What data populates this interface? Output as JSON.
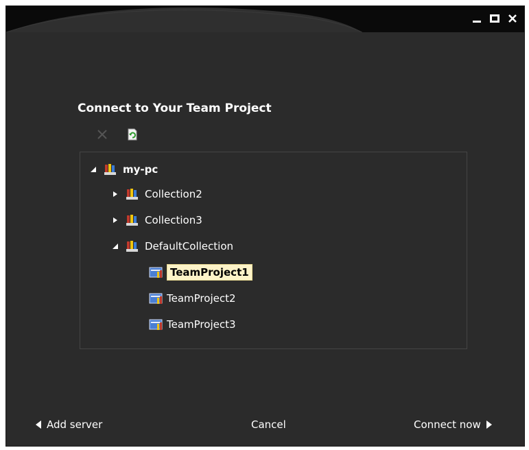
{
  "window": {
    "controls": {
      "minimize": "minimize-icon",
      "maximize": "maximize-icon",
      "close": "close-icon"
    }
  },
  "dialog": {
    "title": "Connect to Your Team Project",
    "toolbar": {
      "delete_icon": "delete-x-icon",
      "refresh_icon": "refresh-icon"
    }
  },
  "tree": {
    "server": {
      "label": "my-pc",
      "expanded": true
    },
    "collections": [
      {
        "label": "Collection2",
        "expanded": false
      },
      {
        "label": "Collection3",
        "expanded": false
      },
      {
        "label": "DefaultCollection",
        "expanded": true
      }
    ],
    "projects": [
      {
        "label": "TeamProject1",
        "selected": true
      },
      {
        "label": "TeamProject2",
        "selected": false
      },
      {
        "label": "TeamProject3",
        "selected": false
      }
    ]
  },
  "footer": {
    "add_server": "Add server",
    "cancel": "Cancel",
    "connect_now": "Connect now"
  },
  "colors": {
    "background": "#2b2b2b",
    "titlebar": "#0a0a0a",
    "selection": "#fdf3c8",
    "text": "#ffffff"
  }
}
